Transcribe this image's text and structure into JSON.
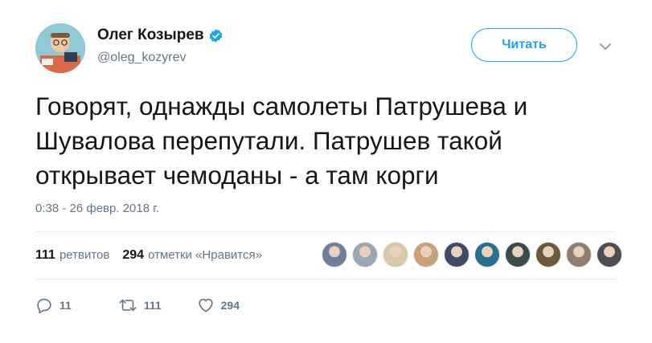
{
  "author": {
    "display_name": "Олег Козырев",
    "handle": "@oleg_kozyrev",
    "verified": true
  },
  "follow_button_label": "Читать",
  "tweet": {
    "text_lines": [
      "Говорят, однажды самолеты Патрушева и",
      "Шувалова перепутали. Патрушев такой",
      "открывает чемоданы - а там корги"
    ],
    "timestamp": "0:38 - 26 февр. 2018 г."
  },
  "stats": {
    "retweets_count": "111",
    "retweets_label": "ретвитов",
    "likes_count": "294",
    "likes_label": "отметки «Нравится»"
  },
  "likers": [
    {
      "avatar_color": "#6e7f9a"
    },
    {
      "avatar_color": "#9aa8b5"
    },
    {
      "avatar_color": "#d7c9a8"
    },
    {
      "avatar_color": "#c9a07a"
    },
    {
      "avatar_color": "#3f4b66"
    },
    {
      "avatar_color": "#2a6f8f"
    },
    {
      "avatar_color": "#3b4a4a"
    },
    {
      "avatar_color": "#6b5a3a"
    },
    {
      "avatar_color": "#8f7d6d"
    },
    {
      "avatar_color": "#4d4d55"
    }
  ],
  "actions": {
    "replies_count": "11",
    "retweets_count": "111",
    "likes_count": "294"
  },
  "colors": {
    "accent": "#1da1f2",
    "secondary_text": "#657786",
    "primary_text": "#14171a",
    "divider": "#e6ecf0"
  }
}
